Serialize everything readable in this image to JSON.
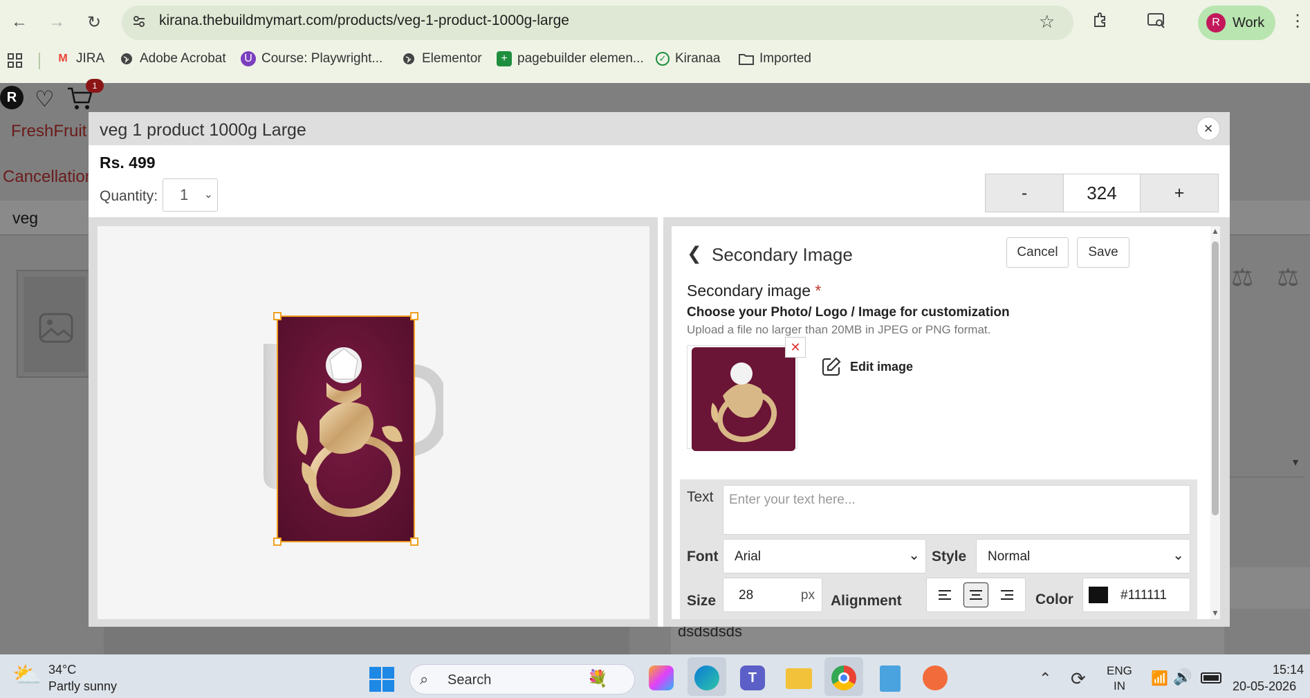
{
  "browser": {
    "url": "kirana.thebuildmymart.com/products/veg-1-product-1000g-large",
    "profile_initial": "R",
    "profile_label": "Work",
    "bookmarks": [
      {
        "label": "JIRA",
        "icon": "gmail-icon",
        "color": "#ea4335"
      },
      {
        "label": "Adobe Acrobat",
        "icon": "globe-icon",
        "color": "#333333"
      },
      {
        "label": "Course: Playwright...",
        "icon": "course-icon",
        "color": "#7b3fbf"
      },
      {
        "label": "Elementor",
        "icon": "globe-icon",
        "color": "#333333"
      },
      {
        "label": "pagebuilder elemen...",
        "icon": "sheets-icon",
        "color": "#1e8e3e"
      },
      {
        "label": "Kiranaa",
        "icon": "check-icon",
        "color": "#1e8e3e"
      },
      {
        "label": "Imported",
        "icon": "folder-icon",
        "color": "#333333"
      }
    ]
  },
  "background_page": {
    "avatar_initial": "R",
    "cart_count": "1",
    "brand_text": "FreshFruit",
    "cancel_text": "Cancellation",
    "search_value": "veg",
    "bottom_text": "dsdsdsds"
  },
  "modal": {
    "title": "veg 1 product 1000g Large",
    "price": "Rs. 499",
    "quantity_label": "Quantity:",
    "quantity_value": "1",
    "stepper": {
      "minus": "-",
      "value": "324",
      "plus": "+"
    },
    "close_label": "×"
  },
  "editor": {
    "panel_title": "Secondary Image",
    "cancel_label": "Cancel",
    "save_label": "Save",
    "field_label": "Secondary image",
    "required_mark": "*",
    "choose_label": "Choose your Photo/ Logo / Image for customization",
    "upload_hint": "Upload a file no larger than 20MB in JPEG or PNG format.",
    "edit_image_label": "Edit image",
    "remove_label": "✕",
    "text_label": "Text",
    "text_placeholder": "Enter your text here...",
    "font_label": "Font",
    "font_value": "Arial",
    "style_label": "Style",
    "style_value": "Normal",
    "size_label": "Size",
    "size_value": "28",
    "size_unit": "px",
    "alignment_label": "Alignment",
    "alignment_selected": "center",
    "color_label": "Color",
    "color_value": "#111111"
  },
  "taskbar": {
    "weather_temp": "34°C",
    "weather_desc": "Partly sunny",
    "search_label": "Search",
    "lang_top": "ENG",
    "lang_bottom": "IN",
    "time": "15:14",
    "date": "20-05-2026"
  },
  "colors": {
    "accent_orange": "#f0a020",
    "ring_background": "#6a1436",
    "required_red": "#c0392b",
    "profile_bg": "#b9e5b0"
  }
}
